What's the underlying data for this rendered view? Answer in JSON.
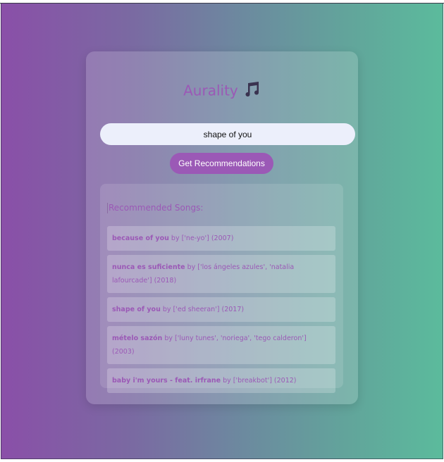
{
  "app": {
    "title": "Aurality",
    "title_icon": "music-notes-icon"
  },
  "search": {
    "value": "shape of you",
    "placeholder": ""
  },
  "button": {
    "label": "Get Recommendations"
  },
  "results": {
    "heading": "Recommended Songs:",
    "songs": [
      {
        "title": "because of you",
        "by": " by ",
        "rest": "['ne-yo'] (2007)"
      },
      {
        "title": "nunca es suficiente",
        "by": " by ",
        "rest": "['los ángeles azules', 'natalia lafourcade'] (2018)"
      },
      {
        "title": "shape of you",
        "by": " by ",
        "rest": "['ed sheeran'] (2017)"
      },
      {
        "title": "mételo sazón",
        "by": " by ",
        "rest": "['luny tunes', 'noriega', 'tego calderon'] (2003)"
      },
      {
        "title": "baby i'm yours - feat. irfrane",
        "by": " by ",
        "rest": "['breakbot'] (2012)"
      }
    ]
  },
  "colors": {
    "accent": "#9b59b6",
    "input_bg": "#eceffb",
    "gradient_start": "#8a4fa8",
    "gradient_end": "#5bbb9c"
  }
}
